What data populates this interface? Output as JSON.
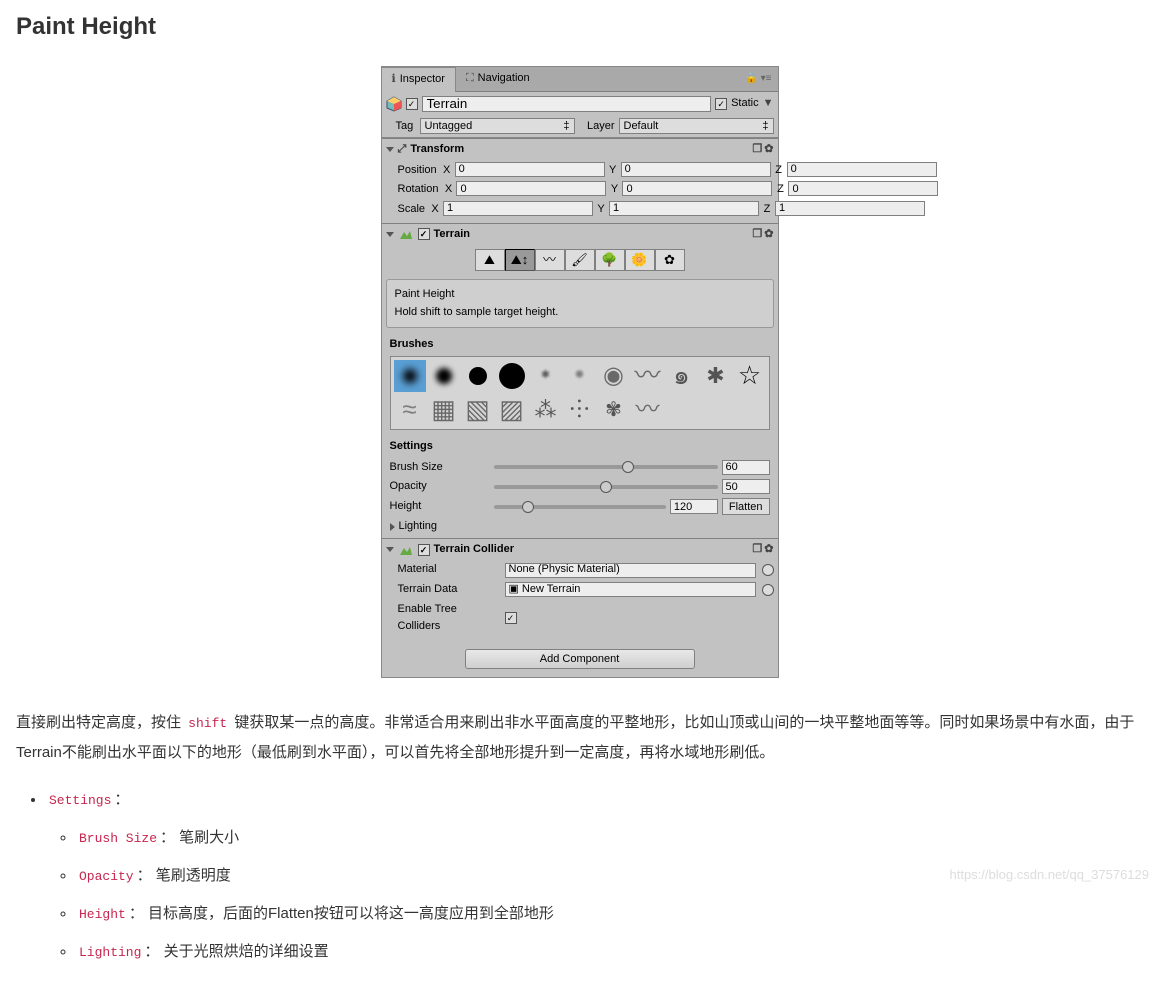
{
  "page": {
    "title": "Paint Height",
    "paragraph_pre": "直接刷出特定高度，按住 ",
    "paragraph_code": "shift",
    "paragraph_post": " 键获取某一点的高度。非常适合用来刷出非水平面高度的平整地形，比如山顶或山间的一块平整地面等等。同时如果场景中有水面，由于Terrain不能刷出水平面以下的地形（最低刷到水平面），可以首先将全部地形提升到一定高度，再将水域地形刷低。",
    "bullet_settings": "Settings",
    "bullet_colon": "：",
    "sub_bullets": [
      {
        "code": "Brush Size",
        "text": "： 笔刷大小"
      },
      {
        "code": "Opacity",
        "text": "： 笔刷透明度"
      },
      {
        "code": "Height",
        "text": "： 目标高度，后面的Flatten按钮可以将这一高度应用到全部地形"
      },
      {
        "code": "Lighting",
        "text": "： 关于光照烘焙的详细设置"
      }
    ],
    "watermark": "https://blog.csdn.net/qq_37576129"
  },
  "inspector": {
    "tab_inspector": "Inspector",
    "tab_navigation": "Navigation",
    "obj_name": "Terrain",
    "static_label": "Static",
    "tag_label": "Tag",
    "tag_value": "Untagged",
    "layer_label": "Layer",
    "layer_value": "Default",
    "transform": {
      "header": "Transform",
      "position": "Position",
      "rotation": "Rotation",
      "scale": "Scale",
      "pos": {
        "x": "0",
        "y": "0",
        "z": "0"
      },
      "rot": {
        "x": "0",
        "y": "0",
        "z": "0"
      },
      "scl": {
        "x": "1",
        "y": "1",
        "z": "1"
      }
    },
    "terrain": {
      "header": "Terrain",
      "hint_title": "Paint Height",
      "hint_sub": "Hold shift to sample target height.",
      "brushes_label": "Brushes",
      "settings_label": "Settings",
      "brush_size_label": "Brush Size",
      "brush_size_val": "60",
      "opacity_label": "Opacity",
      "opacity_val": "50",
      "height_label": "Height",
      "height_val": "120",
      "flatten_label": "Flatten",
      "lighting_label": "Lighting"
    },
    "collider": {
      "header": "Terrain Collider",
      "material_label": "Material",
      "material_value": "None (Physic Material)",
      "terrain_data_label": "Terrain Data",
      "terrain_data_value": "New Terrain",
      "enable_tree_label": "Enable Tree Colliders"
    },
    "add_component": "Add Component"
  }
}
